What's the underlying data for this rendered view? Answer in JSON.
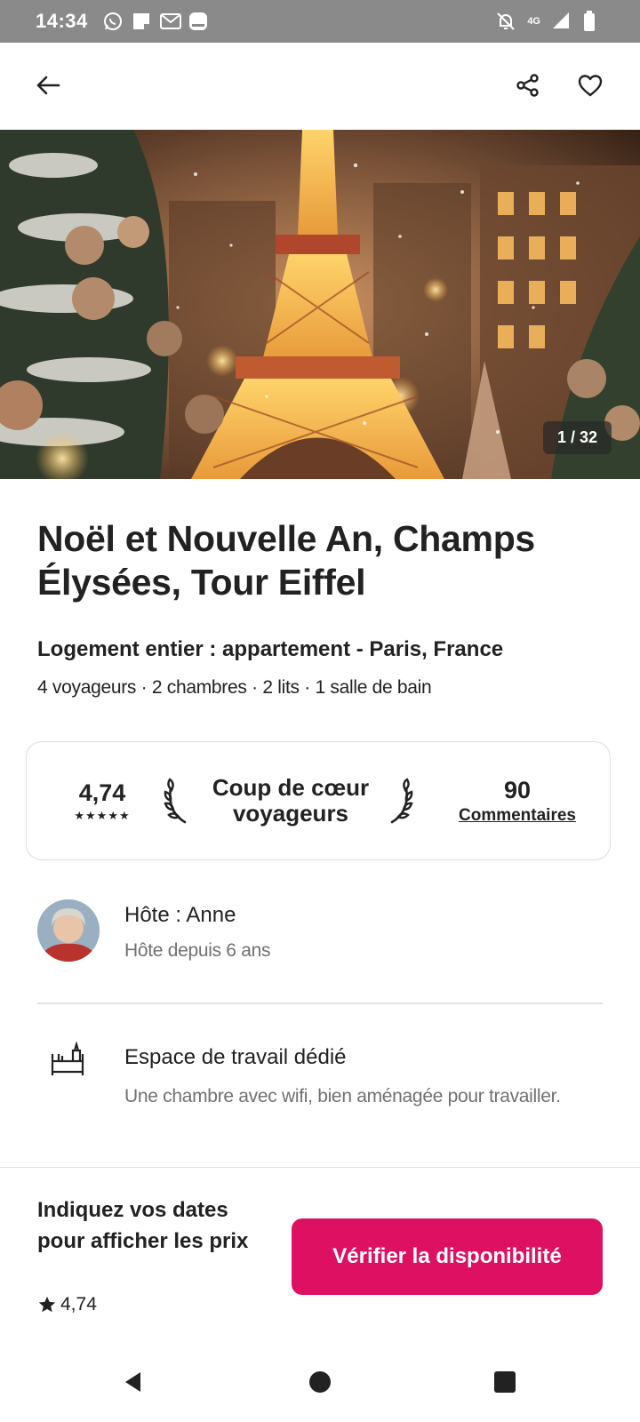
{
  "status_bar": {
    "time": "14:34",
    "network": "4G",
    "icons": [
      "whatsapp-icon",
      "notes-icon",
      "gmail-icon",
      "app-icon",
      "mute-icon",
      "signal-icon",
      "battery-icon"
    ]
  },
  "nav": {
    "icons": [
      "back-arrow-icon",
      "share-icon",
      "heart-icon"
    ]
  },
  "hero": {
    "photo_counter": "1 / 32"
  },
  "listing": {
    "title": "Noël et Nouvelle An, Champs Élysées, Tour Eiffel",
    "subtitle": "Logement entier : appartement - Paris, France",
    "details": "4 voyageurs · 2 chambres · 2 lits · 1 salle de bain"
  },
  "rating_card": {
    "score": "4,74",
    "stars": "★★★★★",
    "favorite_label": "Coup de cœur voyageurs",
    "reviews_count": "90",
    "reviews_label": "Commentaires"
  },
  "host": {
    "name": "Hôte : Anne",
    "since": "Hôte depuis 6 ans"
  },
  "amenity": {
    "title": "Espace de travail dédié",
    "description": "Une chambre avec wifi, bien aménagée pour travailler."
  },
  "booking": {
    "price_prompt": "Indiquez vos dates pour afficher les prix",
    "rating": "4,74",
    "button_label": "Vérifier la disponibilité",
    "accent_color": "#dd1062"
  },
  "system_nav": {
    "icons": [
      "back-triangle-icon",
      "home-circle-icon",
      "recents-square-icon"
    ]
  }
}
